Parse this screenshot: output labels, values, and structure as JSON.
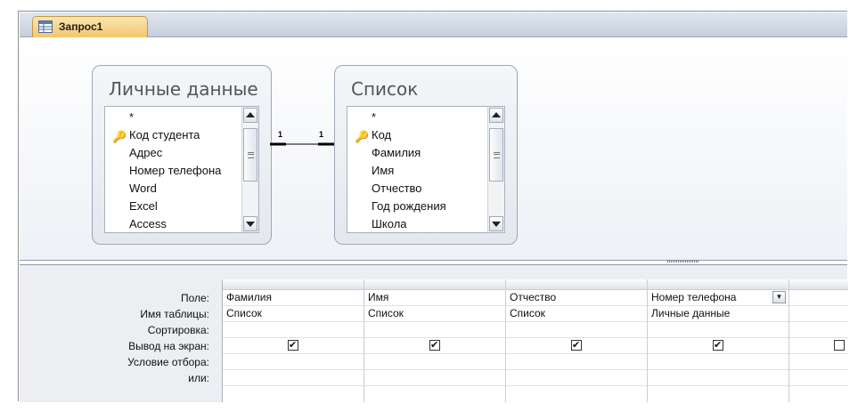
{
  "tab": {
    "label": "Запрос1",
    "icon": "query-icon"
  },
  "tables": [
    {
      "title": "Личные данные",
      "fields": [
        {
          "name": "*",
          "key": false
        },
        {
          "name": "Код студента",
          "key": true
        },
        {
          "name": "Адрес",
          "key": false
        },
        {
          "name": "Номер телефона",
          "key": false
        },
        {
          "name": "Word",
          "key": false
        },
        {
          "name": "Excel",
          "key": false
        },
        {
          "name": "Access",
          "key": false
        }
      ]
    },
    {
      "title": "Список",
      "fields": [
        {
          "name": "*",
          "key": false
        },
        {
          "name": "Код",
          "key": true
        },
        {
          "name": "Фамилия",
          "key": false
        },
        {
          "name": "Имя",
          "key": false
        },
        {
          "name": "Отчество",
          "key": false
        },
        {
          "name": "Год рождения",
          "key": false
        },
        {
          "name": "Школа",
          "key": false
        }
      ]
    }
  ],
  "relationship": {
    "left": "1",
    "right": "1"
  },
  "grid": {
    "row_labels": [
      "Поле:",
      "Имя таблицы:",
      "Сортировка:",
      "Вывод на экран:",
      "Условие отбора:",
      "или:"
    ],
    "columns": [
      {
        "field": "Фамилия",
        "table": "Список",
        "sort": "",
        "show": true
      },
      {
        "field": "Имя",
        "table": "Список",
        "sort": "",
        "show": true
      },
      {
        "field": "Отчество",
        "table": "Список",
        "sort": "",
        "show": true
      },
      {
        "field": "Номер телефона",
        "table": "Личные данные",
        "sort": "",
        "show": true,
        "dropdown": true
      },
      {
        "field": "",
        "table": "",
        "sort": "",
        "show": false
      }
    ]
  },
  "colors": {
    "tab": "#f3c56c",
    "tabstrip": "#c5cfdd",
    "grid_bg": "#eceef1"
  }
}
